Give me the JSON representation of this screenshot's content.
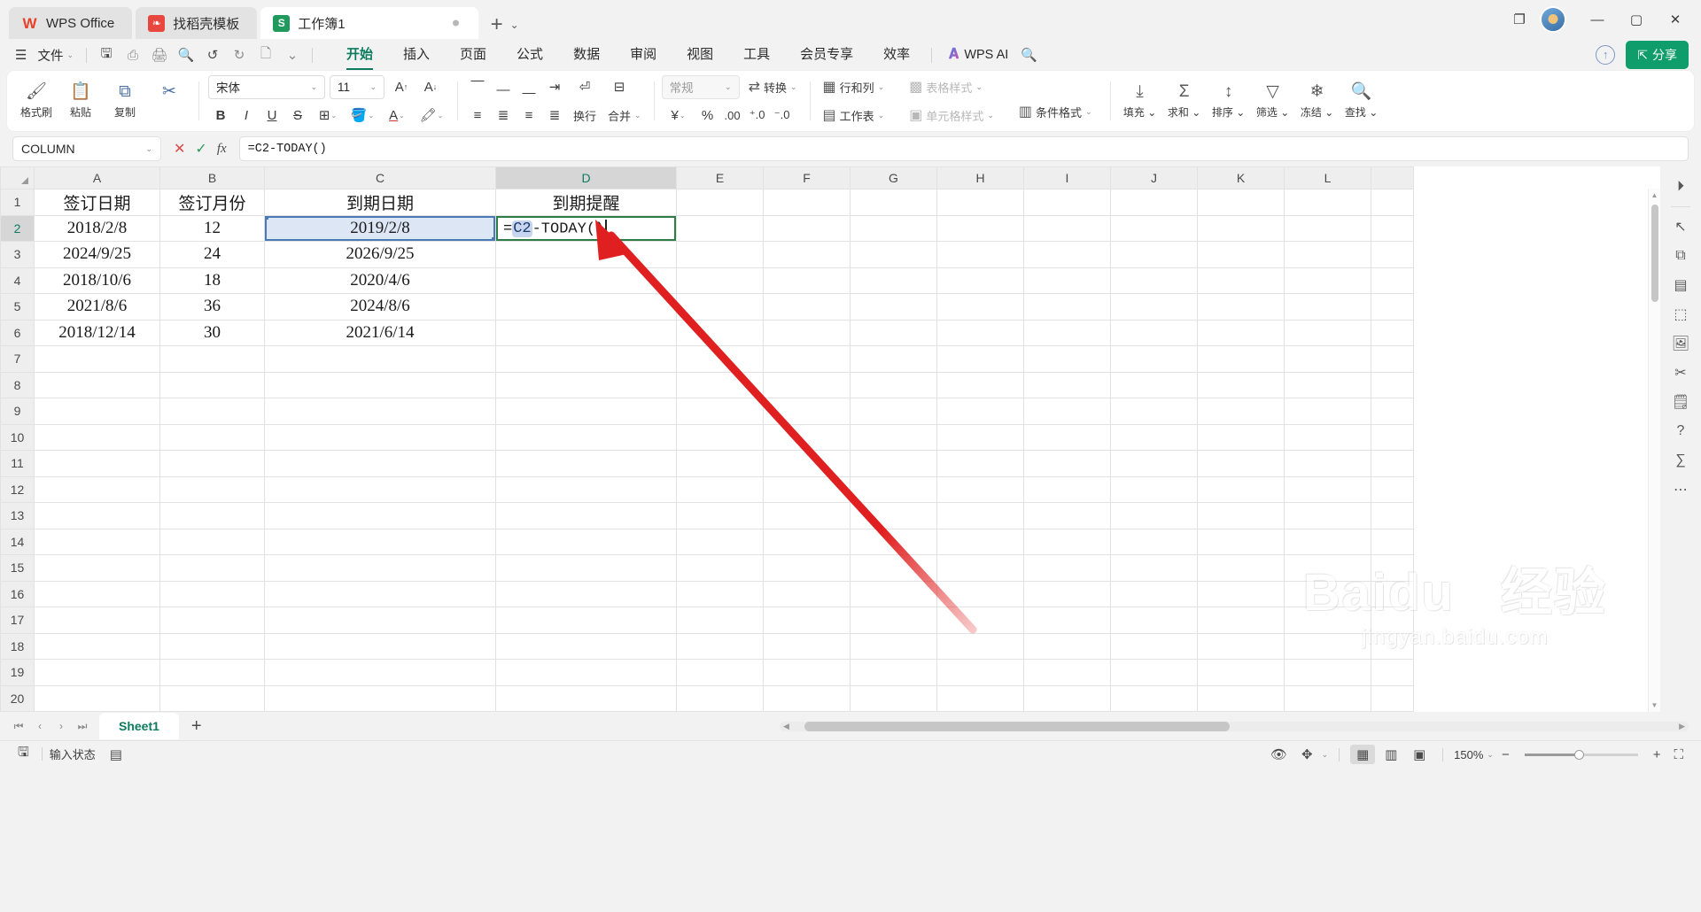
{
  "window": {
    "tabs": [
      {
        "label": "WPS Office",
        "icon": "wps-logo-icon",
        "active": false
      },
      {
        "label": "找稻壳模板",
        "icon": "docer-icon",
        "active": false
      },
      {
        "label": "工作簿1",
        "icon": "spreadsheet-icon",
        "active": true
      }
    ],
    "new_tab": "+",
    "tab_list_chevron": "⌄",
    "controls": {
      "restore": "❐",
      "minimize": "—",
      "maximize": "▢",
      "close": "✕"
    }
  },
  "menubar": {
    "hamburger": "☰",
    "file": "文件",
    "file_chevron": "⌄",
    "quick_icons": [
      "save-icon",
      "cloud-sync-icon",
      "print-icon",
      "print-preview-icon",
      "undo-icon",
      "redo-icon",
      "new-doc-icon"
    ],
    "quick_chevron": "⌄",
    "tabs": [
      {
        "label": "开始",
        "active": true
      },
      {
        "label": "插入",
        "active": false
      },
      {
        "label": "页面",
        "active": false
      },
      {
        "label": "公式",
        "active": false
      },
      {
        "label": "数据",
        "active": false
      },
      {
        "label": "审阅",
        "active": false
      },
      {
        "label": "视图",
        "active": false
      },
      {
        "label": "工具",
        "active": false
      },
      {
        "label": "会员专享",
        "active": false
      },
      {
        "label": "效率",
        "active": false
      }
    ],
    "ai_label": "WPS AI",
    "ai_glyph": "𝐀",
    "search_icon": "search-icon",
    "upload_icon": "upload-cloud-icon",
    "share_label": "分享",
    "share_icon": "share-icon",
    "share_color": "#0f9d6c",
    "accent_color": "#0c7b5e"
  },
  "ribbon": {
    "clipboard": [
      {
        "label": "格式刷",
        "icon": "format-painter-icon"
      },
      {
        "label": "粘贴",
        "icon": "paste-icon",
        "caret": "⌄"
      },
      {
        "label": "复制",
        "icon": "copy-icon",
        "caret": "⌄"
      },
      {
        "label": "剪切",
        "icon": "scissors-icon"
      }
    ],
    "font": {
      "family": "宋体",
      "size": "11",
      "grow_icon": "increase-font-size-icon",
      "shrink_icon": "decrease-font-size-icon",
      "bold": "B",
      "italic": "I",
      "underline": "U",
      "strike": "S",
      "borders_icon": "borders-icon",
      "fill_icon": "fill-color-icon",
      "fontcolor_icon": "font-color-icon",
      "highlight_icon": "highlight-icon"
    },
    "align": {
      "top_icon": "align-top-icon",
      "middle_icon": "align-middle-icon",
      "bottom_icon": "align-bottom-icon",
      "indent_dec_icon": "decrease-indent-icon",
      "wrap_icon": "wrap-text-icon",
      "merge_icon": "merge-cells-icon",
      "left_icon": "align-left-icon",
      "center_icon": "align-center-icon",
      "right_icon": "align-right-icon",
      "justify_icon": "justify-icon",
      "distribute_icon": "distribute-icon",
      "wrap_label": "换行",
      "merge_label": "合并",
      "merge_caret": "⌄"
    },
    "number": {
      "format": "常规",
      "format_caret": "⌄",
      "convert_label": "转换",
      "convert_caret": "⌄",
      "convert_icon": "convert-icon",
      "currency_icon": "currency-icon",
      "percent_icon": "percent-icon",
      "comma_icon": "comma-style-icon",
      "inc_dec_icon": "increase-decimal-icon",
      "dec_dec_icon": "decrease-decimal-icon"
    },
    "styles": [
      {
        "label": "行和列",
        "icon": "rows-columns-icon",
        "caret": "⌄",
        "disabled": false
      },
      {
        "label": "工作表",
        "icon": "worksheet-icon",
        "caret": "⌄",
        "disabled": false
      },
      {
        "label": "表格样式",
        "icon": "table-style-icon",
        "caret": "⌄",
        "disabled": true
      },
      {
        "label": "条件格式",
        "icon": "conditional-format-icon",
        "caret": "⌄",
        "disabled": false
      },
      {
        "label": "单元格样式",
        "icon": "cell-style-icon",
        "caret": "⌄",
        "disabled": true
      }
    ],
    "editing": [
      {
        "label": "填充",
        "icon": "fill-down-icon",
        "caret": "⌄"
      },
      {
        "label": "求和",
        "icon": "autosum-icon",
        "caret": "⌄"
      },
      {
        "label": "排序",
        "icon": "sort-icon",
        "caret": "⌄"
      },
      {
        "label": "筛选",
        "icon": "filter-icon",
        "caret": "⌄"
      },
      {
        "label": "冻结",
        "icon": "freeze-panes-icon",
        "caret": "⌄"
      },
      {
        "label": "查找",
        "icon": "find-icon",
        "caret": "⌄"
      }
    ]
  },
  "formula_bar": {
    "name_box": "COLUMN",
    "name_box_caret": "⌄",
    "cancel_icon": "✕",
    "confirm_icon": "✓",
    "fx_icon": "fx",
    "formula": "=C2-TODAY()"
  },
  "grid": {
    "columns": [
      "A",
      "B",
      "C",
      "D",
      "E",
      "F",
      "G",
      "H",
      "I",
      "J",
      "K",
      "L"
    ],
    "selected_column": "D",
    "selected_row": "2",
    "row_numbers": [
      "1",
      "2",
      "3",
      "4",
      "5",
      "6",
      "7",
      "8",
      "9",
      "10",
      "11",
      "12",
      "13",
      "14",
      "15",
      "16",
      "17",
      "18",
      "19",
      "20"
    ],
    "rows": [
      {
        "n": "1",
        "a": "签订日期",
        "b": "签订月份",
        "c": "到期日期",
        "d": "到期提醒"
      },
      {
        "n": "2",
        "a": "2018/2/8",
        "b": "12",
        "c": "2019/2/8",
        "d": ""
      },
      {
        "n": "3",
        "a": "2024/9/25",
        "b": "24",
        "c": "2026/9/25",
        "d": ""
      },
      {
        "n": "4",
        "a": "2018/10/6",
        "b": "18",
        "c": "2020/4/6",
        "d": ""
      },
      {
        "n": "5",
        "a": "2021/8/6",
        "b": "36",
        "c": "2024/8/6",
        "d": ""
      },
      {
        "n": "6",
        "a": "2018/12/14",
        "b": "30",
        "c": "2021/6/14",
        "d": ""
      },
      {
        "n": "7",
        "a": "",
        "b": "",
        "c": "",
        "d": ""
      },
      {
        "n": "8",
        "a": "",
        "b": "",
        "c": "",
        "d": ""
      },
      {
        "n": "9",
        "a": "",
        "b": "",
        "c": "",
        "d": ""
      },
      {
        "n": "10",
        "a": "",
        "b": "",
        "c": "",
        "d": ""
      },
      {
        "n": "11",
        "a": "",
        "b": "",
        "c": "",
        "d": ""
      },
      {
        "n": "12",
        "a": "",
        "b": "",
        "c": "",
        "d": ""
      },
      {
        "n": "13",
        "a": "",
        "b": "",
        "c": "",
        "d": ""
      },
      {
        "n": "14",
        "a": "",
        "b": "",
        "c": "",
        "d": ""
      },
      {
        "n": "15",
        "a": "",
        "b": "",
        "c": "",
        "d": ""
      },
      {
        "n": "16",
        "a": "",
        "b": "",
        "c": "",
        "d": ""
      },
      {
        "n": "17",
        "a": "",
        "b": "",
        "c": "",
        "d": ""
      },
      {
        "n": "18",
        "a": "",
        "b": "",
        "c": "",
        "d": ""
      },
      {
        "n": "19",
        "a": "",
        "b": "",
        "c": "",
        "d": ""
      },
      {
        "n": "20",
        "a": "",
        "b": "",
        "c": "",
        "d": ""
      }
    ],
    "editing_cell": {
      "address": "D2",
      "prefix": "=",
      "reference": "C2",
      "suffix": "-TODAY()",
      "reference_highlight_color": "#c7d6ee",
      "border_color": "#2e7d46"
    },
    "active_selection": {
      "address": "C2",
      "fill": "#dce6f4",
      "border": "#4a7ab5"
    }
  },
  "right_panel": {
    "icons": [
      "collapse-icon",
      "cursor-icon",
      "layers-icon",
      "chart-panel-icon",
      "crop-icon",
      "image-panel-icon",
      "scissors-panel-icon",
      "picture-icon",
      "help-icon",
      "formula-panel-icon",
      "more-icon"
    ]
  },
  "sheet_tabs": {
    "nav": [
      "⏮",
      "‹",
      "›",
      "⏭"
    ],
    "tabs": [
      {
        "label": "Sheet1",
        "active": true
      }
    ],
    "add": "+"
  },
  "status_bar": {
    "left_icon": "cell-mode-icon",
    "mode": "输入状态",
    "layout_icon": "layout-icon",
    "eye_icon": "eye-icon",
    "fit_icon": "move-icon",
    "fit_caret": "⌄",
    "views": [
      {
        "icon": "normal-view-icon",
        "active": true
      },
      {
        "icon": "page-layout-icon",
        "active": false
      },
      {
        "icon": "page-break-icon",
        "active": false
      }
    ],
    "zoom": "150%",
    "zoom_caret": "⌄",
    "zoom_out": "−",
    "zoom_in": "+",
    "fullscreen_icon": "fullscreen-icon"
  },
  "annotation": {
    "arrow_color": "#e02020",
    "arrow_desc": "red-arrow-pointing-to-D2"
  },
  "watermark": {
    "brand": "Baidu",
    "suffix": "经验",
    "url": "jingyan.baidu.com"
  }
}
